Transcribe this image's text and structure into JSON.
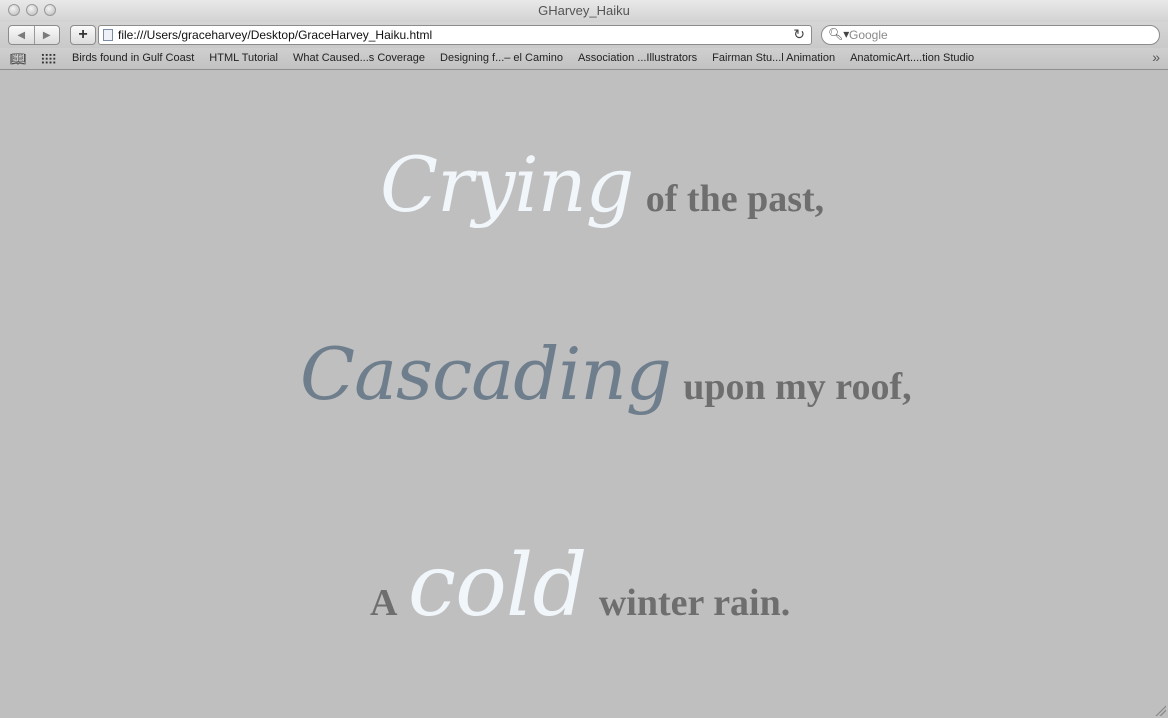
{
  "window": {
    "title": "GHarvey_Haiku"
  },
  "toolbar": {
    "back_glyph": "◀",
    "forward_glyph": "▶",
    "add_glyph": "+",
    "url": "file:///Users/graceharvey/Desktop/GraceHarvey_Haiku.html",
    "reload_glyph": "↻",
    "search_placeholder": "Google",
    "search_glyph": "🔍︎▾"
  },
  "bookmarks": {
    "book_glyph": "📖︎",
    "items": [
      "Birds found in Gulf Coast",
      "HTML Tutorial",
      "What Caused...s Coverage",
      "Designing f...– el Camino",
      "Association ...Illustrators",
      "Fairman Stu...l Animation",
      "AnatomicArt....tion Studio"
    ],
    "more_glyph": "»"
  },
  "poem": {
    "line1": {
      "script": "Crying",
      "rest": "of the past,"
    },
    "line2": {
      "script": "Cascading",
      "rest": "upon my roof,"
    },
    "line3": {
      "lead": "A",
      "script": "cold",
      "rest": "winter rain."
    }
  },
  "colors": {
    "page_background": "#bfbfbf",
    "script_light": "#f1f6fb",
    "script_blue": "#6f7e8c",
    "serif_gray": "#6e6e6e"
  }
}
